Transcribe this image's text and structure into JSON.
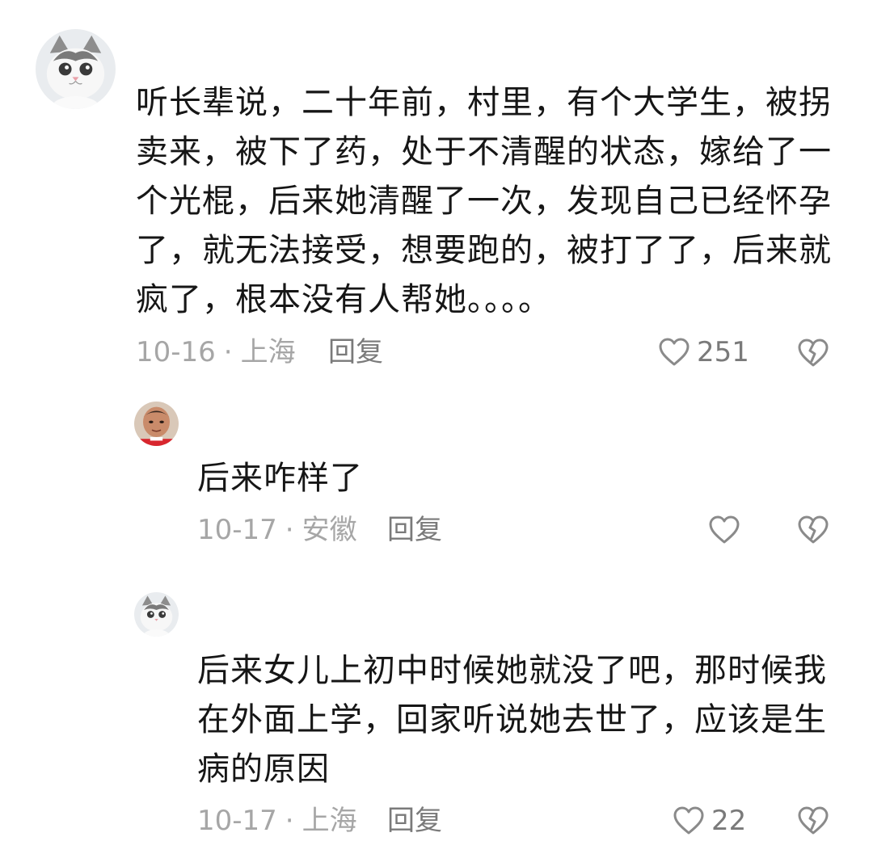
{
  "comments": [
    {
      "avatar": "cat-avatar",
      "text": "听长辈说，二十年前，村里，有个大学生，被拐卖来，被下了药，处于不清醒的状态，嫁给了一个光棍，后来她清醒了一次，发现自己已经怀孕了，就无法接受，想要跑的，被打了了，后来就疯了，根本没有人帮她。。。。",
      "date": "10-16",
      "location": "上海",
      "reply_label": "回复",
      "like_count": "251"
    },
    {
      "avatar": "person-avatar",
      "text": "后来咋样了",
      "date": "10-17",
      "location": "安徽",
      "reply_label": "回复",
      "like_count": ""
    },
    {
      "avatar": "cat-avatar",
      "text": "后来女儿上初中时候她就没了吧，那时候我在外面上学，回家听说她去世了，应该是生病的原因",
      "date": "10-17",
      "location": "上海",
      "reply_label": "回复",
      "like_count": "22"
    }
  ],
  "meta_separator": "·",
  "icons": {
    "like": "heart-outline-icon",
    "dislike": "broken-heart-icon"
  },
  "colors": {
    "text": "#161616",
    "meta": "#a6a6a6",
    "reply": "#7a7a7a",
    "icon": "#8a8a8a"
  }
}
